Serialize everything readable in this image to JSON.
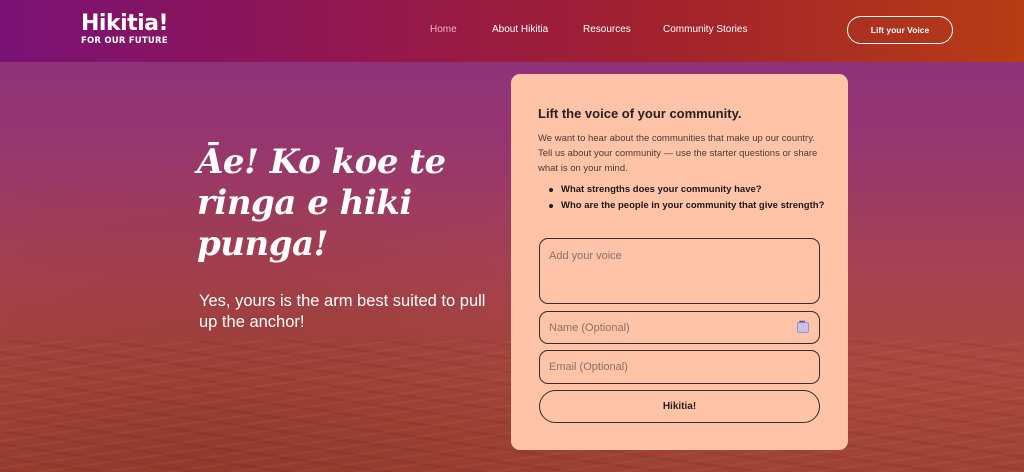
{
  "header": {
    "logo_main": "Hikitia!",
    "logo_sub": "FOR OUR FUTURE",
    "nav": [
      "Home",
      "About Hikitia",
      "Resources",
      "Community Stories"
    ],
    "cta_label": "Lift your Voice"
  },
  "hero": {
    "title": "Āe! Ko koe te ringa e hiki punga!",
    "subtitle": "Yes, yours is the arm best suited to pull up the anchor!"
  },
  "form": {
    "heading": "Lift the voice of your community.",
    "description": "We want to hear about the communities that make up our country. Tell us about your community — use the starter questions or share what is on your mind.",
    "questions": [
      "What strengths does your community have?",
      "Who are the people in your community that give strength?"
    ],
    "voice_placeholder": "Add your voice",
    "name_placeholder": "Name (Optional)",
    "email_placeholder": "Email (Optional)",
    "submit_label": "Hikitia!"
  },
  "colors": {
    "card_bg": "#ffc4a7",
    "nav_active": "#f7b2c7",
    "header_start": "#7a1175",
    "header_end": "#b63d14"
  },
  "icons": {
    "password_manager": "password-key-icon"
  }
}
